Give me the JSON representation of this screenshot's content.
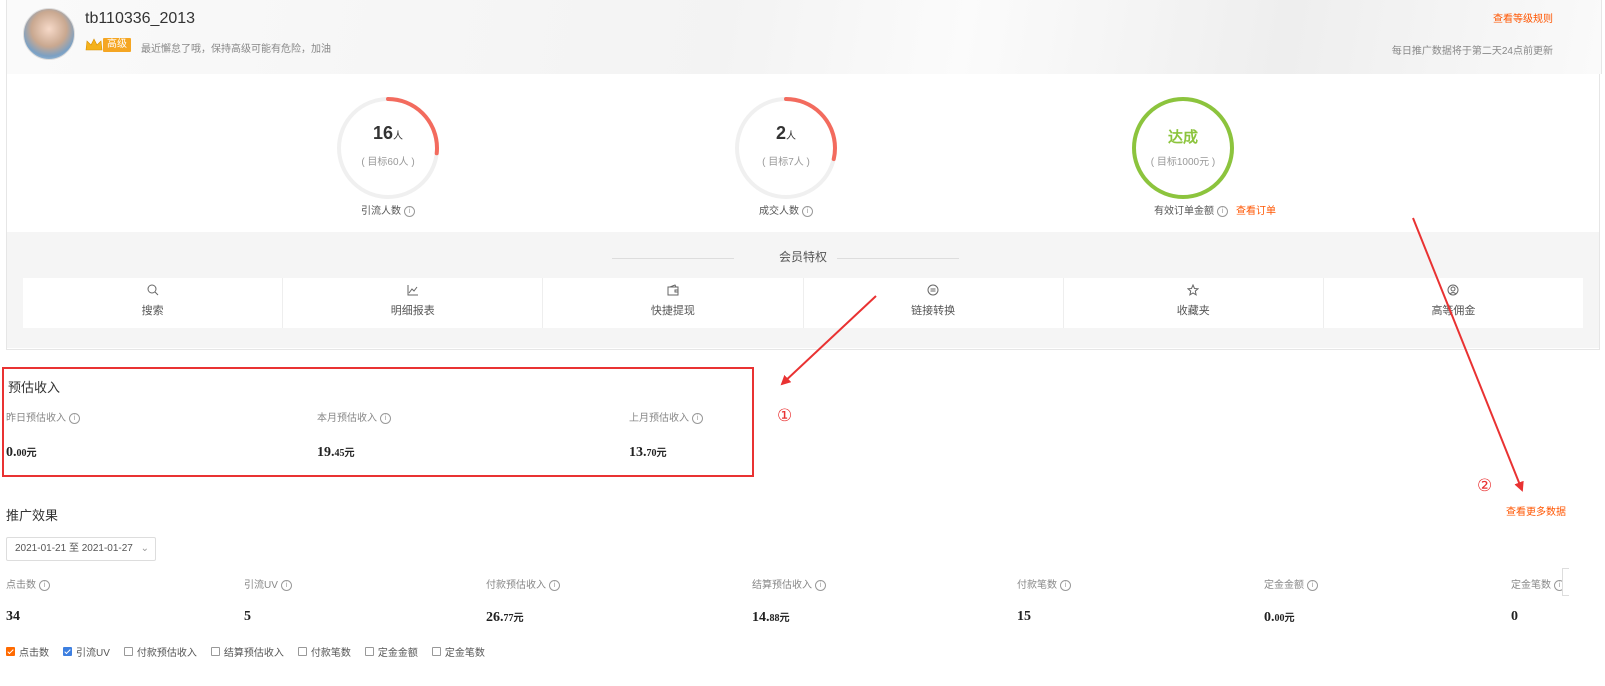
{
  "header": {
    "username": "tb110336_2013",
    "level": "高级",
    "level_tip": "最近懈怠了哦，保持高级可能有危险，加油",
    "rules_link": "查看等级规则",
    "update_tip": "每日推广数据将于第二天24点前更新"
  },
  "gauges": [
    {
      "value": "16",
      "unit": "人",
      "target": "( 目标60人 )",
      "label": "引流人数",
      "progress": 0.267,
      "color": "#f36b5e"
    },
    {
      "value": "2",
      "unit": "人",
      "target": "( 目标7人 )",
      "label": "成交人数",
      "progress": 0.286,
      "color": "#f36b5e"
    },
    {
      "value": "达成",
      "unit": "",
      "target": "( 目标1000元 )",
      "label": "有效订单金额",
      "progress": 1.0,
      "color": "#8cc43d",
      "link": "查看订单"
    }
  ],
  "privileges": {
    "title": "会员特权",
    "items": [
      {
        "label": "搜索",
        "icon": "search-icon"
      },
      {
        "label": "明细报表",
        "icon": "chart-icon"
      },
      {
        "label": "快捷提现",
        "icon": "wallet-icon"
      },
      {
        "label": "链接转换",
        "icon": "link-convert-icon"
      },
      {
        "label": "收藏夹",
        "icon": "star-icon"
      },
      {
        "label": "高等佣金",
        "icon": "commission-icon"
      }
    ]
  },
  "income": {
    "title": "预估收入",
    "items": [
      {
        "label": "昨日预估收入",
        "int": "0.",
        "dec": "00元"
      },
      {
        "label": "本月预估收入",
        "int": "19.",
        "dec": "45元"
      },
      {
        "label": "上月预估收入",
        "int": "13.",
        "dec": "70元"
      }
    ]
  },
  "annotations": {
    "mark1": "①",
    "mark2": "②"
  },
  "promotion": {
    "title": "推广效果",
    "more_link": "查看更多数据",
    "date_start": "2021-01-21",
    "date_sep": "至",
    "date_end": "2021-01-27",
    "metrics": [
      {
        "label": "点击数",
        "int": "34",
        "dec": ""
      },
      {
        "label": "引流UV",
        "int": "5",
        "dec": ""
      },
      {
        "label": "付款预估收入",
        "int": "26.",
        "dec": "77元"
      },
      {
        "label": "结算预估收入",
        "int": "14.",
        "dec": "88元"
      },
      {
        "label": "付款笔数",
        "int": "15",
        "dec": ""
      },
      {
        "label": "定金金额",
        "int": "0.",
        "dec": "00元"
      },
      {
        "label": "定金笔数",
        "int": "0",
        "dec": ""
      }
    ],
    "checkboxes": [
      {
        "label": "点击数",
        "checked": true,
        "color": "#ff6a00"
      },
      {
        "label": "引流UV",
        "checked": true,
        "color": "#3d7fe0"
      },
      {
        "label": "付款预估收入",
        "checked": false
      },
      {
        "label": "结算预估收入",
        "checked": false
      },
      {
        "label": "付款笔数",
        "checked": false
      },
      {
        "label": "定金金额",
        "checked": false
      },
      {
        "label": "定金笔数",
        "checked": false
      }
    ]
  }
}
